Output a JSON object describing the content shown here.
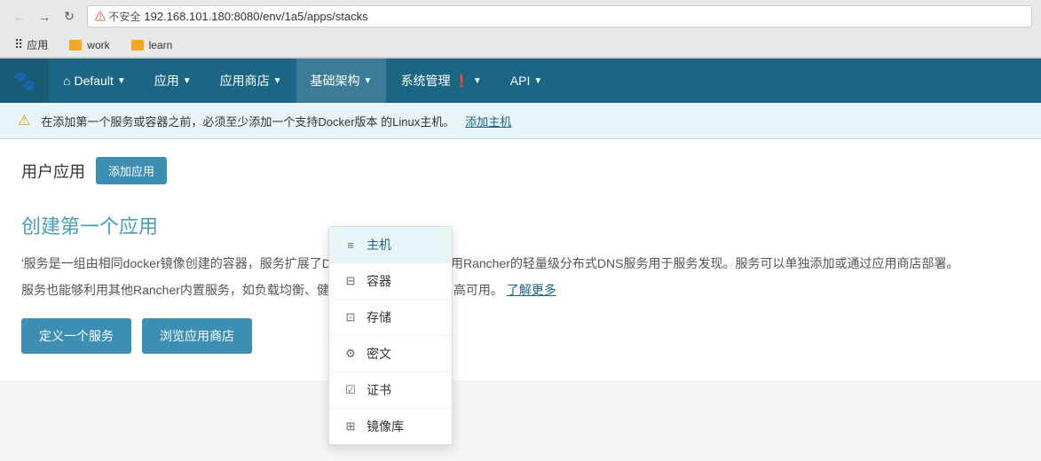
{
  "browser": {
    "address": "192.168.101.180:8080/env/1a5/apps/stacks",
    "security_label": "不安全",
    "back_btn": "←",
    "forward_btn": "→",
    "refresh_btn": "↻"
  },
  "bookmarks": {
    "apps_label": "应用",
    "work_label": "work",
    "learn_label": "learn"
  },
  "navbar": {
    "default_label": "Default",
    "apps_label": "应用",
    "app_store_label": "应用商店",
    "infra_label": "基础架构",
    "system_label": "系统管理",
    "api_label": "API"
  },
  "alert": {
    "text": "在添加第一个服务或容器之前，必须至少添加一个支持Docker版本 的Linux主机。",
    "link_text": "添加主机"
  },
  "page": {
    "title": "用户应用",
    "add_btn": "添加应用",
    "content_title": "创建第一个应用",
    "desc1": "'服务是一组由相同docker镜像创建的容器，服务扩展了Docker的\"link\"概念以利用Rancher的轻量级分布式DNS服务用于服务发现。服务可以单独添加或通过应用商店部署。",
    "desc2": "服务也能够利用其他Rancher内置服务，如负载均衡、健康监控、升级支持以及高可用。",
    "learn_more": "了解更多",
    "define_btn": "定义一个服务",
    "browse_btn": "浏览应用商店"
  },
  "dropdown": {
    "items": [
      {
        "id": "host",
        "label": "主机",
        "icon": "≡",
        "active": true
      },
      {
        "id": "container",
        "label": "容器",
        "icon": "⊟",
        "active": false
      },
      {
        "id": "storage",
        "label": "存储",
        "icon": "⊡",
        "active": false
      },
      {
        "id": "secret",
        "label": "密文",
        "icon": "⚙",
        "active": false
      },
      {
        "id": "cert",
        "label": "证书",
        "icon": "☑",
        "active": false
      },
      {
        "id": "registry",
        "label": "镜像库",
        "icon": "⊞",
        "active": false
      }
    ]
  }
}
